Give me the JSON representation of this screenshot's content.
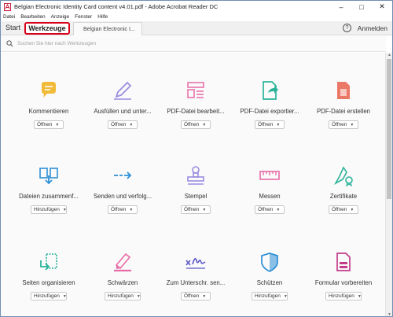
{
  "window": {
    "title": "Belgian Electronic Identity Card content v4.01.pdf - Adobe Acrobat Reader DC",
    "minimize": "–",
    "maximize": "□",
    "close": "✕"
  },
  "menu": [
    "Datei",
    "Bearbeiten",
    "Anzeige",
    "Fenster",
    "Hilfe"
  ],
  "tabs": {
    "start": "Start",
    "tools": "Werkzeuge",
    "document": "Belgian Electronic I..."
  },
  "header": {
    "help": "?",
    "signin": "Anmelden"
  },
  "search": {
    "placeholder": "Suchen Sie hier nach Werkzeugen"
  },
  "tools": [
    {
      "label": "Kommentieren",
      "button": "Öffnen",
      "icon": "comment-icon",
      "color": "#f0b323"
    },
    {
      "label": "Ausfüllen und unter...",
      "button": "Öffnen",
      "icon": "fill-sign-icon",
      "color": "#9b8de0"
    },
    {
      "label": "PDF-Datei bearbeit...",
      "button": "Öffnen",
      "icon": "edit-pdf-icon",
      "color": "#e86aa6"
    },
    {
      "label": "PDF-Datei exportier...",
      "button": "Öffnen",
      "icon": "export-pdf-icon",
      "color": "#2bb39a"
    },
    {
      "label": "PDF-Datei erstellen",
      "button": "Öffnen",
      "icon": "create-pdf-icon",
      "color": "#e8604c"
    },
    {
      "label": "Dateien zusammenf...",
      "button": "Hinzufügen",
      "icon": "combine-files-icon",
      "color": "#2d8fd5"
    },
    {
      "label": "Senden und verfolg...",
      "button": "Öffnen",
      "icon": "send-track-icon",
      "color": "#2d8fd5"
    },
    {
      "label": "Stempel",
      "button": "Öffnen",
      "icon": "stamp-icon",
      "color": "#9b8de0"
    },
    {
      "label": "Messen",
      "button": "Öffnen",
      "icon": "measure-icon",
      "color": "#e86aa6"
    },
    {
      "label": "Zertifikate",
      "button": "Öffnen",
      "icon": "certificate-icon",
      "color": "#2bb39a"
    },
    {
      "label": "Seiten organisieren",
      "button": "Hinzufügen",
      "icon": "organize-pages-icon",
      "color": "#2bb39a"
    },
    {
      "label": "Schwärzen",
      "button": "Hinzufügen",
      "icon": "redact-icon",
      "color": "#e86aa6"
    },
    {
      "label": "Zum Unterschr. sen...",
      "button": "Öffnen",
      "icon": "send-signature-icon",
      "color": "#5b57c8"
    },
    {
      "label": "Schützen",
      "button": "Hinzufügen",
      "icon": "protect-icon",
      "color": "#2d8fd5"
    },
    {
      "label": "Formular vorbereiten",
      "button": "Hinzufügen",
      "icon": "prepare-form-icon",
      "color": "#c43b8a"
    }
  ]
}
